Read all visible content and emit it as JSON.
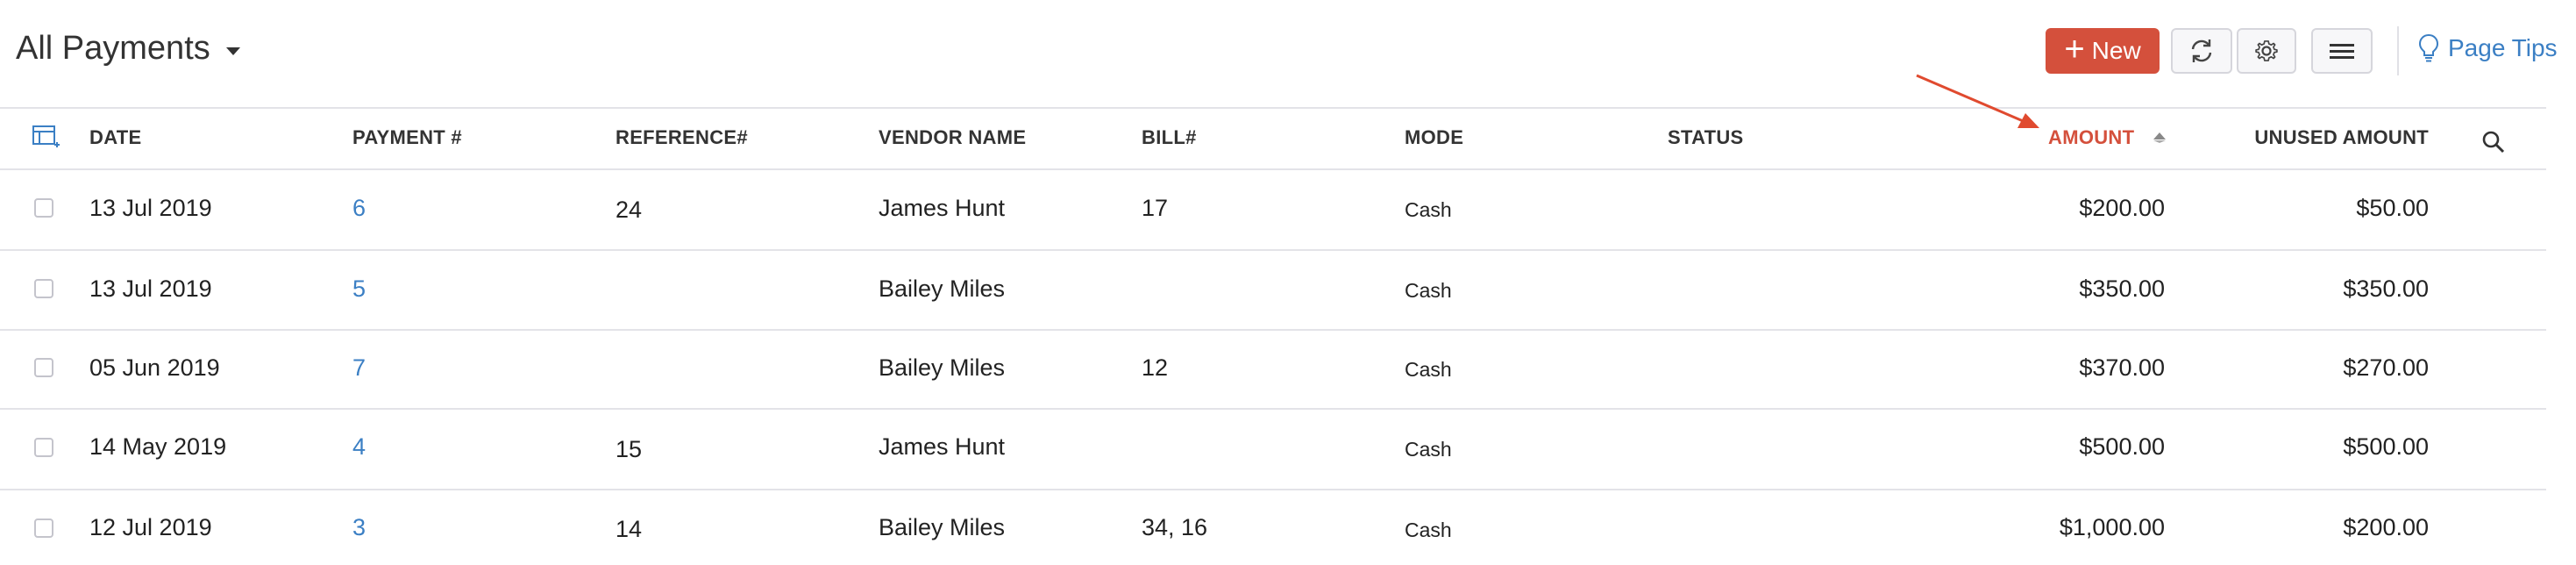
{
  "header": {
    "title": "All Payments",
    "new_label": "New",
    "page_tips_label": "Page Tips",
    "accent_color": "#d4503c",
    "link_color": "#3b7fc4"
  },
  "columns": {
    "date": "DATE",
    "payment": "PAYMENT #",
    "reference": "REFERENCE#",
    "vendor": "VENDOR NAME",
    "bill": "BILL#",
    "mode": "MODE",
    "status": "STATUS",
    "amount": "AMOUNT",
    "unused": "UNUSED AMOUNT"
  },
  "sort": {
    "column": "AMOUNT",
    "direction": "ascending"
  },
  "rows": [
    {
      "date": "13 Jul 2019",
      "payment": "6",
      "reference": "24",
      "vendor": "James Hunt",
      "bill": "17",
      "mode": "Cash",
      "status": "",
      "amount": "$200.00",
      "unused": "$50.00"
    },
    {
      "date": "13 Jul 2019",
      "payment": "5",
      "reference": "",
      "vendor": "Bailey Miles",
      "bill": "",
      "mode": "Cash",
      "status": "",
      "amount": "$350.00",
      "unused": "$350.00"
    },
    {
      "date": "05 Jun 2019",
      "payment": "7",
      "reference": "",
      "vendor": "Bailey Miles",
      "bill": "12",
      "mode": "Cash",
      "status": "",
      "amount": "$370.00",
      "unused": "$270.00"
    },
    {
      "date": "14 May 2019",
      "payment": "4",
      "reference": "15",
      "vendor": "James Hunt",
      "bill": "",
      "mode": "Cash",
      "status": "",
      "amount": "$500.00",
      "unused": "$500.00"
    },
    {
      "date": "12 Jul 2019",
      "payment": "3",
      "reference": "14",
      "vendor": "Bailey Miles",
      "bill": "34, 16",
      "mode": "Cash",
      "status": "",
      "amount": "$1,000.00",
      "unused": "$200.00"
    }
  ],
  "annotation": {
    "arrow_color": "#e04a2f",
    "points_to": "AMOUNT"
  }
}
